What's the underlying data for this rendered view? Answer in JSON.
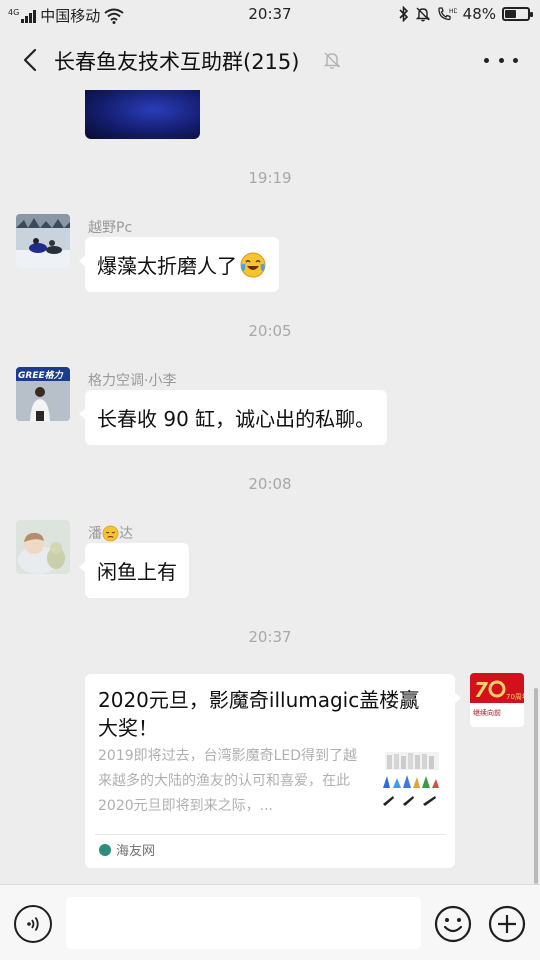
{
  "status_bar": {
    "network_type": "4G",
    "carrier": "中国移动",
    "time": "20:37",
    "battery_label": "48%",
    "battery_level": 0.48,
    "icons": [
      "signal-icon",
      "wifi-icon",
      "bluetooth-icon",
      "mute-bell-icon",
      "hd-call-icon",
      "battery-icon"
    ]
  },
  "nav": {
    "title": "长春鱼友技术互助群(215)",
    "icons": [
      "back-chevron-icon",
      "mute-bell-icon",
      "more-dots-icon"
    ]
  },
  "messages": [
    {
      "type": "timestamp",
      "text": "19:19"
    },
    {
      "type": "text",
      "sender": "越野Pc",
      "text": "爆藻太折磨人了",
      "emoji": "crying-laughing-emoji"
    },
    {
      "type": "timestamp",
      "text": "20:05"
    },
    {
      "type": "text",
      "sender": "格力空调·小李",
      "text": "长春收 90 缸，诚心出的私聊。",
      "avatar_text": "GREE格力"
    },
    {
      "type": "timestamp",
      "text": "20:08"
    },
    {
      "type": "text",
      "sender_part1": "潘",
      "sender_part2": "达",
      "sender_emoji": "pensive-emoji",
      "text": "闲鱼上有"
    },
    {
      "type": "timestamp",
      "text": "20:37"
    },
    {
      "type": "link_card",
      "title": "2020元旦，影魔奇illumagic盖楼赢大奖！",
      "description": "2019即将过去，台湾影魔奇LED得到了越来越多的大陆的渔友的认可和喜爱，在此2020元旦即将到来之际，...",
      "source": "海友网",
      "avatar_text_top": "70周年",
      "avatar_text_bottom": "继续向前"
    }
  ],
  "input_bar": {
    "placeholder": "",
    "icons": [
      "voice-icon",
      "emoji-icon",
      "plus-icon"
    ]
  },
  "colors": {
    "background": "#ededed",
    "bubble": "#ffffff",
    "timestamp": "#a8a8a8",
    "sender_name": "#9a9a9a",
    "source_brand": "#2c8d7b"
  }
}
